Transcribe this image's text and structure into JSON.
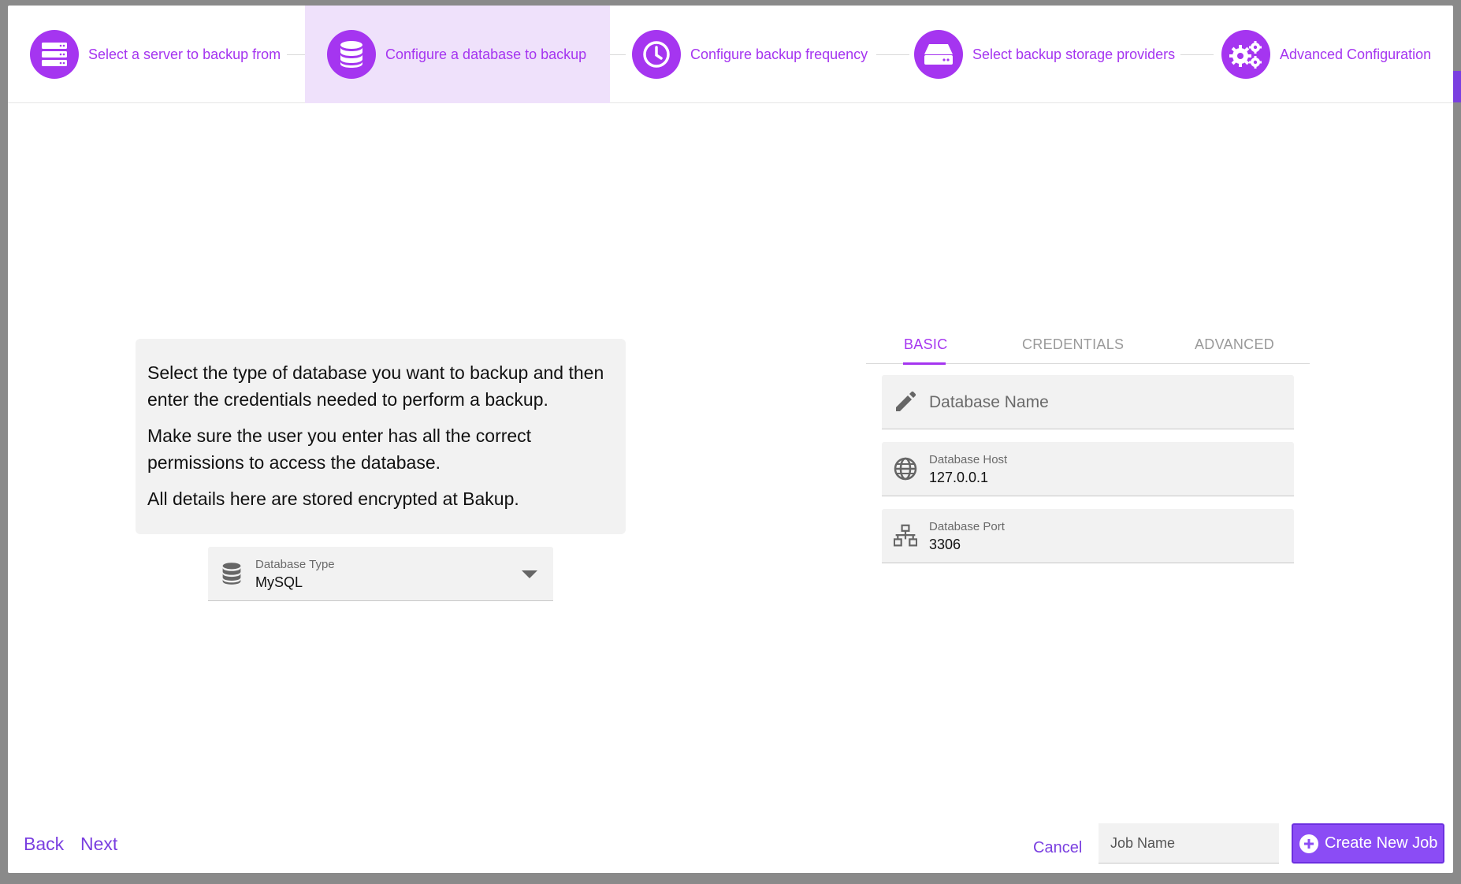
{
  "stepper": {
    "steps": [
      {
        "label": "Select a server to backup from",
        "icon": "server-icon",
        "active": false
      },
      {
        "label": "Configure a database to backup",
        "icon": "database-icon",
        "active": true
      },
      {
        "label": "Configure backup frequency",
        "icon": "clock-icon",
        "active": false
      },
      {
        "label": "Select backup storage providers",
        "icon": "hard-drive-icon",
        "active": false
      },
      {
        "label": "Advanced Configuration",
        "icon": "gears-icon",
        "active": false
      }
    ]
  },
  "info": {
    "paragraph1": "Select the type of database you want to backup and then enter the credentials needed to perform a backup.",
    "paragraph2": "Make sure the user you enter has all the correct permissions to access the database.",
    "paragraph3": "All details here are stored encrypted at Bakup."
  },
  "db_type": {
    "label": "Database Type",
    "value": "MySQL"
  },
  "tabs": {
    "basic": "BASIC",
    "credentials": "CREDENTIALS",
    "advanced": "ADVANCED",
    "active": "basic"
  },
  "fields": {
    "db_name": {
      "placeholder": "Database Name",
      "value": ""
    },
    "db_host": {
      "label": "Database Host",
      "value": "127.0.0.1"
    },
    "db_port": {
      "label": "Database Port",
      "value": "3306"
    }
  },
  "footer": {
    "back": "Back",
    "next": "Next",
    "cancel": "Cancel",
    "job_name_placeholder": "Job Name",
    "create": "Create New Job"
  },
  "colors": {
    "accent": "#a535f0",
    "button": "#8b4cf5",
    "link": "#7a3fe0"
  }
}
